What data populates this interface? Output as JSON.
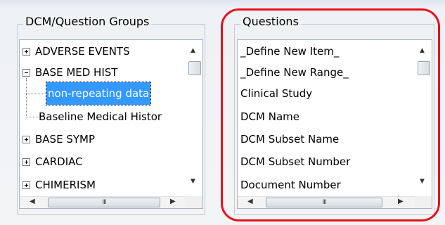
{
  "left_group": {
    "title": "DCM/Question Groups",
    "items": [
      {
        "label": "ADVERSE EVENTS",
        "expander": "plus"
      },
      {
        "label": "BASE MED HIST",
        "expander": "minus"
      },
      {
        "label": "non-repeating data",
        "child": true,
        "selected": true
      },
      {
        "label": "Baseline Medical Histor",
        "child": true
      },
      {
        "label": "BASE SYMP",
        "expander": "plus"
      },
      {
        "label": "CARDIAC",
        "expander": "plus"
      },
      {
        "label": "CHIMERISM",
        "expander": "plus"
      }
    ],
    "hscroll_grip": "III"
  },
  "right_group": {
    "title": "Questions",
    "items": [
      "_Define New Item_",
      "_Define New Range_",
      "Clinical Study",
      "DCM Name",
      "DCM Subset Name",
      "DCM Subset Number",
      "Document Number"
    ],
    "hscroll_grip": "III"
  },
  "icons": {
    "scroll_up": "triangle-up",
    "scroll_down": "triangle-down",
    "scroll_left": "triangle-left",
    "scroll_right": "triangle-right",
    "expand": "plus-box",
    "collapse": "minus-box"
  },
  "colors": {
    "selection": "#3399ff",
    "annotation_oval": "#e8101e"
  }
}
